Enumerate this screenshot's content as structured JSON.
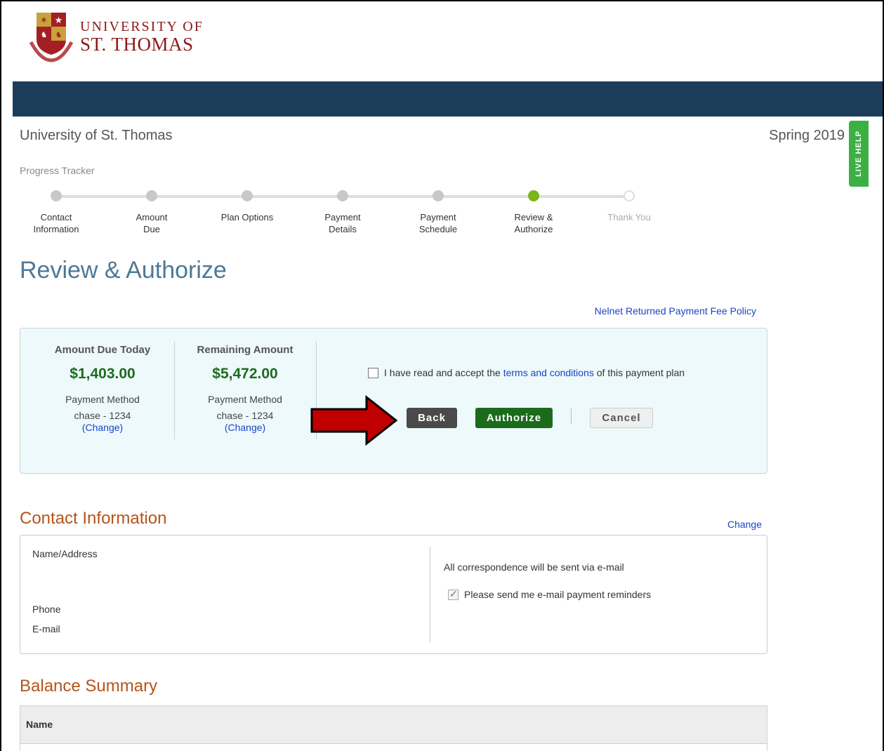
{
  "header": {
    "logo_line1": "UNIVERSITY OF",
    "logo_line2": "ST. THOMAS",
    "school_name": "University of St. Thomas",
    "term": "Spring 2019",
    "live_help": "LIVE HELP"
  },
  "tracker": {
    "title": "Progress Tracker",
    "steps": [
      {
        "label": "Contact Information",
        "state": "done"
      },
      {
        "label": "Amount Due",
        "state": "done"
      },
      {
        "label": "Plan Options",
        "state": "done"
      },
      {
        "label": "Payment Details",
        "state": "done"
      },
      {
        "label": "Payment Schedule",
        "state": "done"
      },
      {
        "label": "Review & Authorize",
        "state": "current"
      },
      {
        "label": "Thank You",
        "state": "future"
      }
    ]
  },
  "page": {
    "title": "Review & Authorize",
    "fee_policy_link": "Nelnet Returned Payment Fee Policy"
  },
  "summary": {
    "due_today": {
      "heading": "Amount Due Today",
      "amount": "$1,403.00",
      "method_label": "Payment Method",
      "method": "chase - 1234",
      "change": "(Change)"
    },
    "remaining": {
      "heading": "Remaining Amount",
      "amount": "$5,472.00",
      "method_label": "Payment Method",
      "method": "chase - 1234",
      "change": "(Change)"
    },
    "accept": {
      "checked": false,
      "before": "I have read and accept the ",
      "link": "terms and conditions",
      "after": " of this payment plan"
    },
    "buttons": {
      "back": "Back",
      "authorize": "Authorize",
      "cancel": "Cancel"
    }
  },
  "contact": {
    "title": "Contact Information",
    "change": "Change",
    "name_address_label": "Name/Address",
    "phone_label": "Phone",
    "email_label": "E-mail",
    "correspondence": "All correspondence will be sent via e-mail",
    "reminders": {
      "checked": true,
      "label": "Please send me e-mail payment reminders"
    }
  },
  "balance": {
    "title": "Balance Summary",
    "columns": [
      "Name"
    ]
  },
  "colors": {
    "navbar": "#1c3d5a",
    "title_blue": "#4d7896",
    "section_orange": "#b5541b",
    "amount_green": "#1e6b1e",
    "tracker_active": "#7cb518",
    "live_help_green": "#3cb043",
    "arrow_red": "#c00000"
  },
  "icons": {
    "logo": "university-crest-icon",
    "arrow": "red-arrow-icon",
    "checkbox": "checkbox-icon"
  }
}
